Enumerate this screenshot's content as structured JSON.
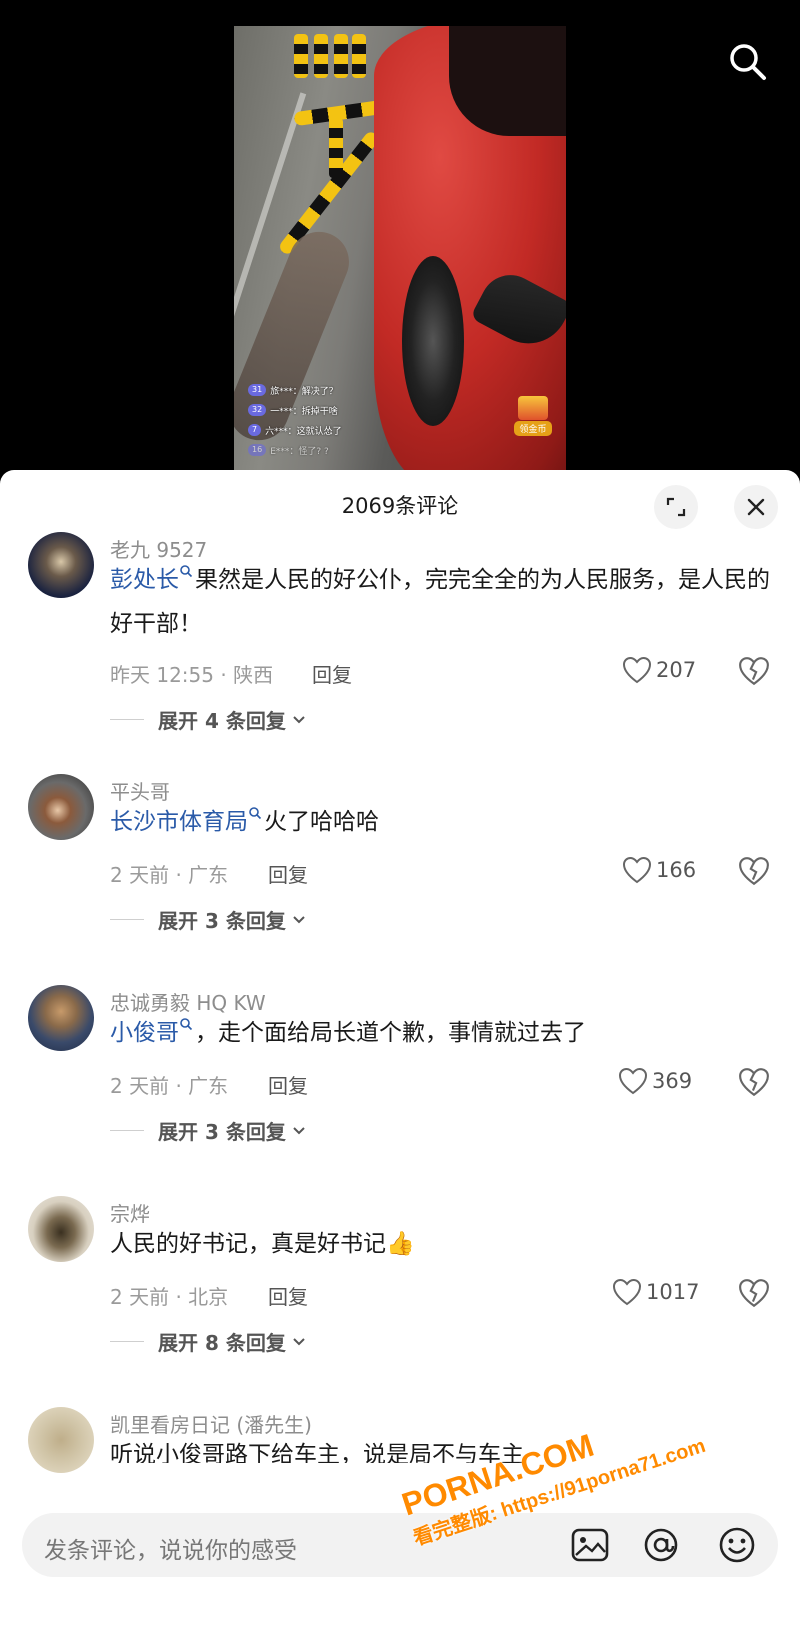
{
  "video": {
    "danmaku": [
      {
        "level": "31",
        "text": "旅***：解决了？"
      },
      {
        "level": "32",
        "text": "一***：拆掉干啥"
      },
      {
        "level": "7",
        "text": "六***：这就认怂了"
      },
      {
        "level": "16",
        "text": "E***：怪了? ?"
      }
    ],
    "coin_label": "领金币"
  },
  "panel": {
    "title": "2069条评论"
  },
  "comments": [
    {
      "username": "老九 9527",
      "mention": "彭处长",
      "text": "果然是人民的好公仆，完完全全的为人民服务，是人民的好干部！",
      "time_location": "昨天 12:55 · 陕西",
      "reply_label": "回复",
      "likes": "207",
      "expand": "展开 4 条回复"
    },
    {
      "username": "平头哥",
      "mention": "长沙市体育局",
      "text": "火了哈哈哈",
      "time_location": "2 天前 · 广东",
      "reply_label": "回复",
      "likes": "166",
      "expand": "展开 3 条回复"
    },
    {
      "username": "忠诚勇毅 HQ KW",
      "mention": "小俊哥",
      "text": "，走个面给局长道个歉，事情就过去了",
      "time_location": "2 天前 · 广东",
      "reply_label": "回复",
      "likes": "369",
      "expand": "展开 3 条回复"
    },
    {
      "username": "宗烨",
      "mention": "",
      "text": "人民的好书记，真是好书记",
      "emoji": "👍",
      "time_location": "2 天前 · 北京",
      "reply_label": "回复",
      "likes": "1017",
      "expand": "展开 8 条回复"
    },
    {
      "username": "凯里看房日记 (潘先生)",
      "text": "听说小俊哥路下给车主，说是局不与车主"
    }
  ],
  "input": {
    "placeholder": "发条评论，说说你的感受"
  },
  "watermark": {
    "main": "PORNA.COM",
    "sub": "看完整版: https://91porna71.com"
  }
}
